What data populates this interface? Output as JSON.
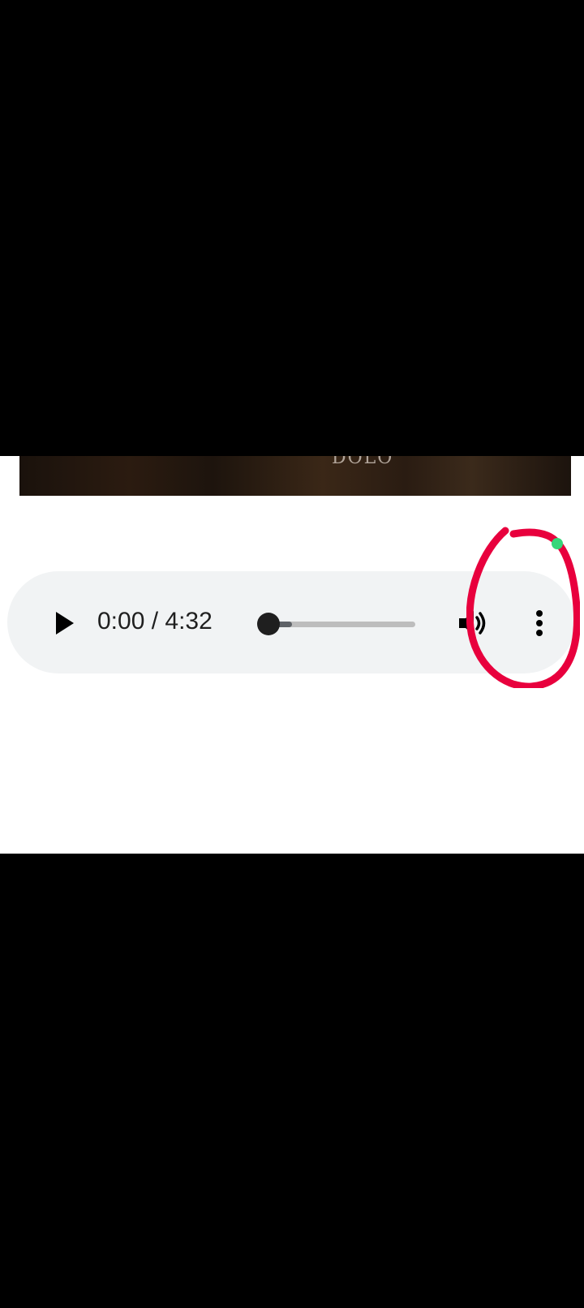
{
  "player": {
    "current_time": "0:00",
    "separator": " / ",
    "duration": "4:32",
    "time_text": "0:00 / 4:32",
    "progress_fraction": 0.0,
    "buffered_fraction": 0.16,
    "icons": {
      "play": "play-icon",
      "volume": "volume-icon",
      "more": "more-vertical-icon"
    }
  },
  "thumbnail": {
    "visible_text_fragment": "DOLO"
  },
  "annotation": {
    "color": "#e8003d",
    "shape": "hand-drawn-ellipse"
  },
  "colors": {
    "player_background": "#f1f3f4",
    "track": "#bdbdbd",
    "buffer": "#5f6368",
    "thumb": "#1f1f1f"
  }
}
